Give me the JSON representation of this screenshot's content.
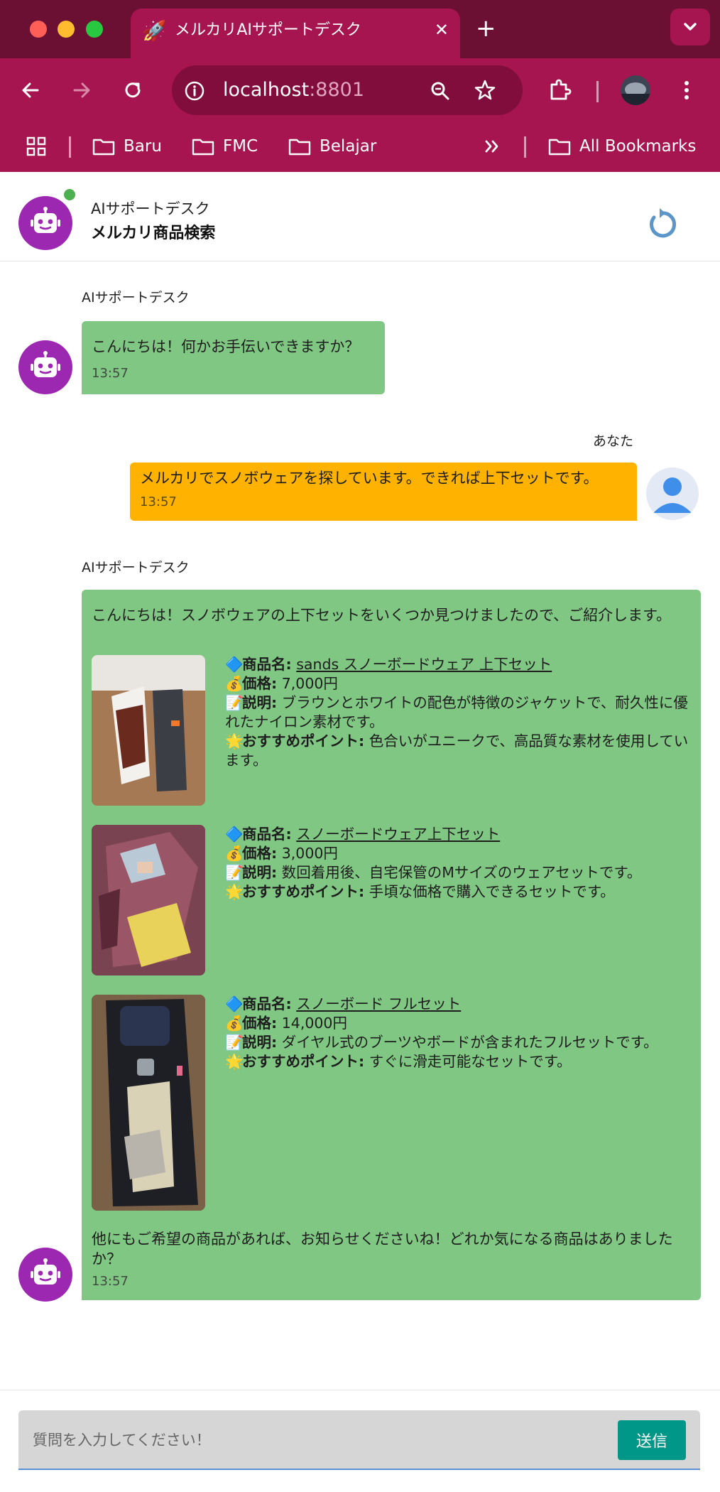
{
  "browser": {
    "tab_title": "メルカリAIサポートデスク",
    "url_host": "localhost",
    "url_port": ":8801",
    "bookmarks": [
      "Baru",
      "FMC",
      "Belajar"
    ],
    "all_bookmarks": "All Bookmarks"
  },
  "header": {
    "subtitle": "AIサポートデスク",
    "title": "メルカリ商品検索"
  },
  "messages": [
    {
      "sender": "AIサポートデスク",
      "text": "こんにちは！何かお手伝いできますか？",
      "time": "13:57"
    },
    {
      "sender": "あなた",
      "text": "メルカリでスノボウェアを探しています。できれば上下セットです。",
      "time": "13:57"
    },
    {
      "sender": "AIサポートデスク",
      "intro": "こんにちは！スノボウェアの上下セットをいくつか見つけましたので、ご紹介します。",
      "labels": {
        "name": "商品名:",
        "price": "価格:",
        "desc": "説明:",
        "point": "おすすめポイント:"
      },
      "items": [
        {
          "name": "sands スノーボードウェア 上下セット",
          "price": "7,000円",
          "desc": "ブラウンとホワイトの配色が特徴のジャケットで、耐久性に優れたナイロン素材です。",
          "point": "色合いがユニークで、高品質な素材を使用しています。"
        },
        {
          "name": "スノーボードウェア上下セット",
          "price": "3,000円",
          "desc": "数回着用後、自宅保管のMサイズのウェアセットです。",
          "point": "手頃な価格で購入できるセットです。"
        },
        {
          "name": "スノーボード フルセット",
          "price": "14,000円",
          "desc": "ダイヤル式のブーツやボードが含まれたフルセットです。",
          "point": "すぐに滑走可能なセットです。"
        }
      ],
      "outro": "他にもご希望の商品があれば、お知らせくださいね！どれか気になる商品はありましたか？",
      "time": "13:57"
    }
  ],
  "input": {
    "placeholder": "質問を入力してください！",
    "send": "送信"
  },
  "colors": {
    "chrome": "#a6154f",
    "bot_bubble": "#81c784",
    "user_bubble": "#ffb300",
    "avatar": "#9c27b0",
    "send": "#009688"
  }
}
